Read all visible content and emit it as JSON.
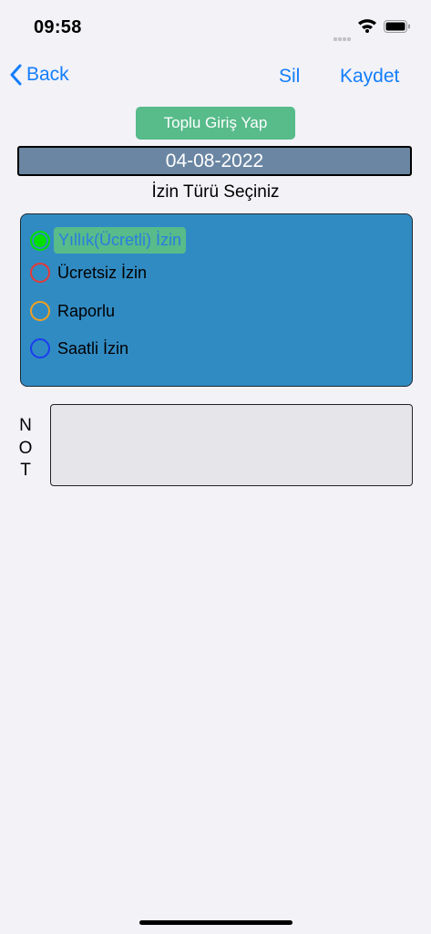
{
  "status_bar": {
    "time": "09:58"
  },
  "nav": {
    "back_label": "Back",
    "delete_label": "Sil",
    "save_label": "Kaydet"
  },
  "bulk_entry_button": "Toplu Giriş Yap",
  "date": "04-08-2022",
  "leave_type_prompt": "İzin Türü Seçiniz",
  "leave_types": [
    {
      "label": "Yıllık(Ücretli) İzin",
      "color": "#00e000",
      "selected": true
    },
    {
      "label": "Ücretsiz İzin",
      "color": "#e53935",
      "selected": false
    },
    {
      "label": "Raporlu",
      "color": "#f0a020",
      "selected": false
    },
    {
      "label": "Saatli İzin",
      "color": "#1a3df0",
      "selected": false
    }
  ],
  "note_label": [
    "N",
    "O",
    "T"
  ],
  "colors": {
    "accent": "#147efb",
    "button_green": "#57bb8a",
    "panel_blue": "#318bc3",
    "date_bg": "#6a86a3"
  }
}
